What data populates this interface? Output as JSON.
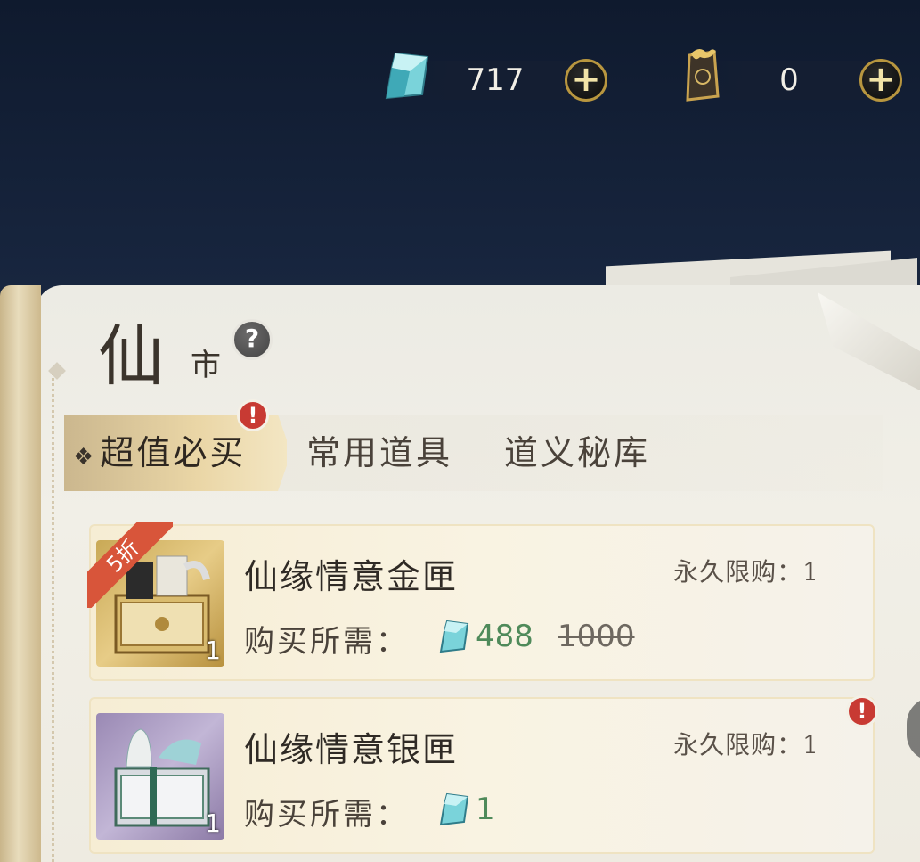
{
  "currencies": [
    {
      "icon": "crystal-gem-icon",
      "value": "717",
      "add_label": "+"
    },
    {
      "icon": "gold-token-icon",
      "value": "0",
      "add_label": "+"
    }
  ],
  "title": {
    "main": "仙",
    "sub": "市",
    "help_label": "?"
  },
  "tabs": [
    {
      "label": "超值必买",
      "active": true,
      "badge": "!"
    },
    {
      "label": "常用道具",
      "active": false
    },
    {
      "label": "道义秘库",
      "active": false
    }
  ],
  "items": [
    {
      "name": "仙缘情意金匣",
      "limit": "永久限购：1",
      "cost_label": "购买所需：",
      "price": "488",
      "original_price": "1000",
      "discount": "5折",
      "count": "1",
      "icon": "gold-chest-icon"
    },
    {
      "name": "仙缘情意银匣",
      "limit": "永久限购：1",
      "cost_label": "购买所需：",
      "price": "1",
      "count": "1",
      "badge": "!",
      "icon": "silver-chest-icon"
    }
  ],
  "colors": {
    "sky": "#1b2a45",
    "page": "#eeebe1",
    "tab_active": "#ead6a6",
    "price_green": "#4f8a5a",
    "badge_red": "#c83a33",
    "gold_border": "#b8963f"
  }
}
